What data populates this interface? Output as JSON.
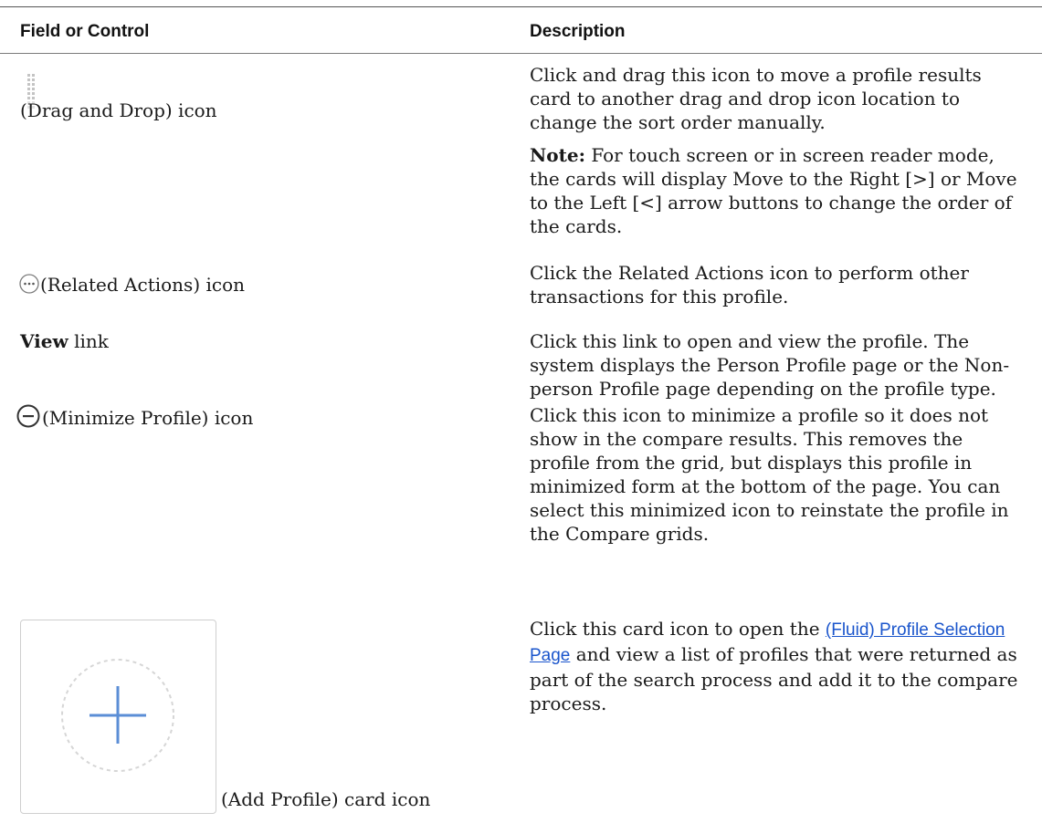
{
  "header": {
    "field_col": "Field or Control",
    "desc_col": "Description"
  },
  "rows": [
    {
      "icon": "drag-and-drop-icon",
      "field_label": "(Drag and Drop) icon",
      "desc": "Click and drag this icon to move a profile results card to another drag and drop icon location to change the sort order manually.",
      "note_label": "Note:",
      "note_text": "For touch screen or in screen reader mode, the cards will display Move to the Right [>] or Move to the Left [<] arrow buttons to change the order of the cards."
    },
    {
      "icon": "related-actions-icon",
      "field_label": "(Related Actions) icon",
      "desc": "Click the Related Actions icon to perform other transactions for this profile."
    },
    {
      "field_bold": "View",
      "field_label": "link",
      "desc": "Click this link to open and view the profile. The system displays the Person Profile page or the Non-person Profile page depending on the profile type."
    },
    {
      "icon": "minimize-profile-icon",
      "field_label": "(Minimize Profile) icon",
      "desc": "Click this icon to minimize a profile so it does not show in the compare results. This removes the profile from the grid, but displays this profile in minimized form at the bottom of the page. You can select this minimized icon to reinstate the profile in the Compare grids."
    },
    {
      "icon": "add-profile-card-icon",
      "field_label": "(Add Profile) card icon",
      "desc_before": "Click this card icon to open the",
      "link_text": "(Fluid) Profile Selection Page",
      "desc_after": "and view a list of profiles that were returned as part of the search process and add it to the compare process."
    }
  ],
  "colors": {
    "link": "#1a55cc",
    "plus": "#5b8ed6",
    "rule": "#555555"
  }
}
